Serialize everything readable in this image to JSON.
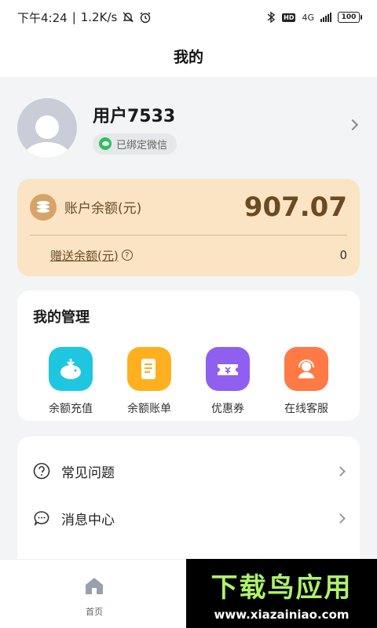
{
  "statusbar": {
    "time": "下午4:24",
    "separator": "|",
    "speed": "1.2K/s",
    "network": "4G",
    "battery": "100"
  },
  "header": {
    "title": "我的"
  },
  "profile": {
    "username": "用户7533",
    "wechat_badge": "已绑定微信"
  },
  "balance": {
    "label": "账户余额(元)",
    "value": "907.07",
    "gift_label": "赠送余额(元)",
    "gift_value": "0",
    "help_glyph": "?"
  },
  "management": {
    "title": "我的管理",
    "items": [
      {
        "label": "余额充值",
        "icon": "piggy-bank-icon",
        "color": "#1fc6e0"
      },
      {
        "label": "余额账单",
        "icon": "bill-scroll-icon",
        "color": "#ffb01f"
      },
      {
        "label": "优惠券",
        "icon": "coupon-icon",
        "color": "#8f5ff0"
      },
      {
        "label": "在线客服",
        "icon": "customer-service-icon",
        "color": "#ff7a45"
      }
    ]
  },
  "menu": {
    "items": [
      {
        "label": "常见问题",
        "icon": "question-circle-icon"
      },
      {
        "label": "消息中心",
        "icon": "message-bubble-icon"
      }
    ]
  },
  "tabbar": {
    "home_label": "首页"
  },
  "watermark": {
    "title": "下载鸟应用",
    "url": "www.xiazainiao.com"
  },
  "colors": {
    "balance_card": "#fbe4c3",
    "balance_text": "#6b4a22",
    "wechat_green": "#2ec05c",
    "watermark_green": "#aef26a"
  }
}
